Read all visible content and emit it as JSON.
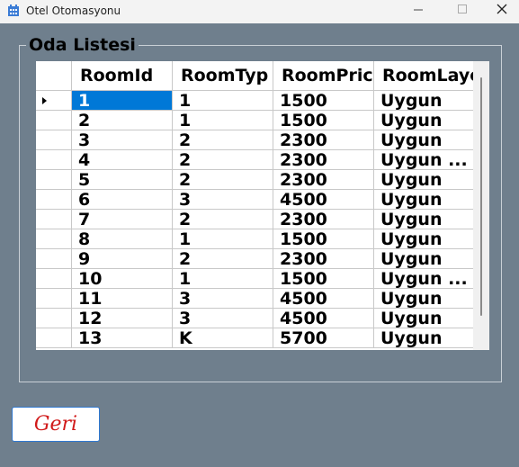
{
  "window": {
    "title": "Otel Otomasyonu",
    "minimize_glyph": "—",
    "maximize_glyph": "☐",
    "close_glyph": "✕"
  },
  "group": {
    "title": "Oda Listesi"
  },
  "grid": {
    "columns": [
      "RoomId",
      "RoomTyp",
      "RoomPric",
      "RoomLaye"
    ],
    "rows": [
      [
        "1",
        "1",
        "1500",
        "Uygun"
      ],
      [
        "2",
        "1",
        "1500",
        "Uygun"
      ],
      [
        "3",
        "2",
        "2300",
        "Uygun"
      ],
      [
        "4",
        "2",
        "2300",
        "Uygun ..."
      ],
      [
        "5",
        "2",
        "2300",
        "Uygun"
      ],
      [
        "6",
        "3",
        "4500",
        "Uygun"
      ],
      [
        "7",
        "2",
        "2300",
        "Uygun"
      ],
      [
        "8",
        "1",
        "1500",
        "Uygun"
      ],
      [
        "9",
        "2",
        "2300",
        "Uygun"
      ],
      [
        "10",
        "1",
        "1500",
        "Uygun ..."
      ],
      [
        "11",
        "3",
        "4500",
        "Uygun"
      ],
      [
        "12",
        "3",
        "4500",
        "Uygun"
      ],
      [
        "13",
        "K",
        "5700",
        "Uygun"
      ]
    ],
    "selected_row": 0
  },
  "actions": {
    "back_label": "Geri"
  },
  "colors": {
    "background": "#6f7f8d",
    "selection": "#0078d7",
    "back_text": "#d11a1a",
    "back_border": "#2f78d0"
  },
  "icons": {
    "app": "hotel-building-icon",
    "row_indicator": "triangle-right-icon"
  }
}
